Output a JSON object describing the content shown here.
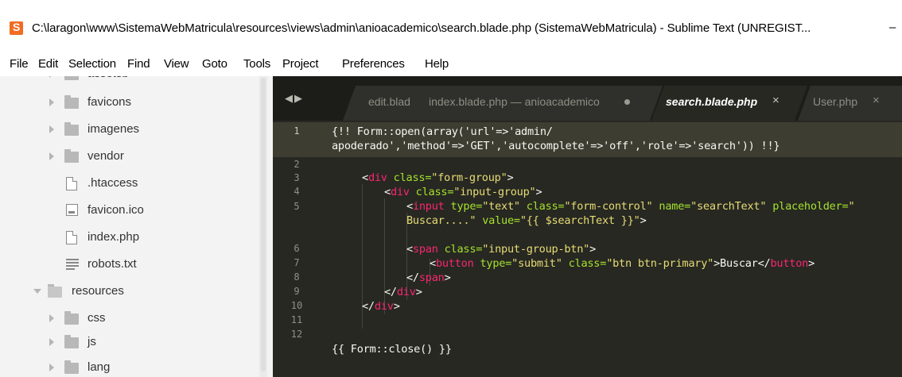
{
  "window": {
    "title": "C:\\laragon\\www\\SistemaWebMatricula\\resources\\views\\admin\\anioacademico\\search.blade.php (SistemaWebMatricula) - Sublime Text (UNREGIST...",
    "minimize_glyph": "–"
  },
  "menu": [
    "File",
    "Edit",
    "Selection",
    "Find",
    "View",
    "Goto",
    "Tools",
    "Project",
    "Preferences",
    "Help"
  ],
  "sidebar": {
    "items": [
      {
        "label": "assetsb",
        "type": "folder",
        "expanded": false
      },
      {
        "label": "favicons",
        "type": "folder",
        "expanded": false
      },
      {
        "label": "imagenes",
        "type": "folder",
        "expanded": false
      },
      {
        "label": "vendor",
        "type": "folder",
        "expanded": false
      },
      {
        "label": ".htaccess",
        "type": "file"
      },
      {
        "label": "favicon.ico",
        "type": "image"
      },
      {
        "label": "index.php",
        "type": "file"
      },
      {
        "label": "robots.txt",
        "type": "text"
      },
      {
        "label": "resources",
        "type": "folder",
        "expanded": true
      },
      {
        "label": "css",
        "type": "folder",
        "expanded": false
      },
      {
        "label": "js",
        "type": "folder",
        "expanded": false
      },
      {
        "label": "lang",
        "type": "folder",
        "expanded": false
      }
    ]
  },
  "tabs": {
    "nav_glyph": "◀▶",
    "items": [
      {
        "label": "edit.blad",
        "active": false
      },
      {
        "label": "index.blade.php — anioacademico",
        "active": false,
        "modified": true
      },
      {
        "label": "search.blade.php",
        "active": true,
        "close": "×"
      },
      {
        "label": "User.php",
        "active": false,
        "close": "×"
      }
    ]
  },
  "editor": {
    "line_numbers": [
      "1",
      "2",
      "3",
      "4",
      "5",
      "6",
      "7",
      "8",
      "9",
      "10",
      "11",
      "12"
    ],
    "current_line": "1",
    "code": {
      "l1a": "{!! Form::open(array('url'=>'admin/",
      "l1b": "apoderado','method'=>'GET','autocomplete'=>'off','role'=>'search')) !!}",
      "l3": {
        "open": "<",
        "tag": "div",
        "attr": " class=",
        "val": "\"form-group\"",
        "close": ">"
      },
      "l4": {
        "open": "<",
        "tag": "div",
        "attr": " class=",
        "val": "\"input-group\"",
        "close": ">"
      },
      "l5a": {
        "open": "<",
        "tag": "input",
        "a1": " type=",
        "v1": "\"text\"",
        "a2": " class=",
        "v2": "\"form-control\"",
        "a3": " name=",
        "v3": "\"searchText\"",
        "a4": " placeholder=",
        "v4": "\""
      },
      "l5b": {
        "v4b": "Buscar....\"",
        "a5": " value=",
        "v5": "\"{{ $searchText }}\"",
        "close": ">"
      },
      "l6": {
        "open": "<",
        "tag": "span",
        "attr": " class=",
        "val": "\"input-group-btn\"",
        "close": ">"
      },
      "l7": {
        "open": "<",
        "tag": "button",
        "a1": " type=",
        "v1": "\"submit\"",
        "a2": " class=",
        "v2": "\"btn btn-primary\"",
        "gt": ">",
        "text": "Buscar",
        "endopen": "</",
        "endtag": "button",
        "endclose": ">"
      },
      "l8": {
        "open": "</",
        "tag": "span",
        "close": ">"
      },
      "l9": {
        "open": "</",
        "tag": "div",
        "close": ">"
      },
      "l10": {
        "open": "</",
        "tag": "div",
        "close": ">"
      },
      "l12": "{{ Form::close() }}"
    }
  },
  "colors": {
    "editor_bg": "#272822",
    "tag": "#f92672",
    "attribute": "#a6e22e",
    "string": "#e6db74",
    "text": "#f8f8f2",
    "sidebar_bg": "#f3f3f3"
  }
}
